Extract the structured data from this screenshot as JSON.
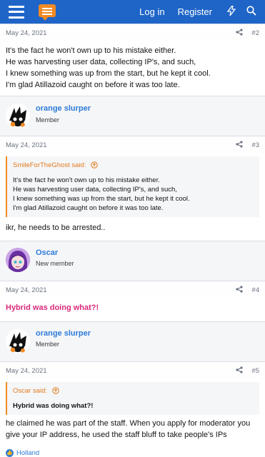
{
  "header": {
    "login": "Log in",
    "register": "Register",
    "menu_icon": "hamburger-icon",
    "logo_icon": "chat-bubble-logo",
    "whats_new_icon": "lightning-icon",
    "search_icon": "search-icon",
    "brand_color": "#1f65c8",
    "logo_color": "#f08a24"
  },
  "posts": [
    {
      "date": "May 24, 2021",
      "number": "#2",
      "lines": [
        "It's the fact he won't own up to his mistake either.",
        "He was harvesting user data, collecting IP's, and such,",
        "I knew something was up from the start, but he kept it cool.",
        "I'm glad Atillazoid caught on before it was too late."
      ]
    },
    {
      "user": "orange slurper",
      "role": "Member",
      "date": "May 24, 2021",
      "number": "#3",
      "quote_author": "SmileForTheGhost said:",
      "quote_lines": [
        "It's the fact he won't own up to his mistake either.",
        "He was harvesting user data, collecting IP's, and such,",
        "I knew something was up from the start, but he kept it cool.",
        "I'm glad Atillazoid caught on before it was too late."
      ],
      "text": "ikr, he needs to be arrested.."
    },
    {
      "user": "Oscar",
      "role": "New member",
      "date": "May 24, 2021",
      "number": "#4",
      "text": "Hybrid was doing what?!"
    },
    {
      "user": "orange slurper",
      "role": "Member",
      "date": "May 24, 2021",
      "number": "#5",
      "quote_author": "Oscar said:",
      "quote_text": "Hybrid was doing what?!",
      "lines": [
        "he claimed he was part of the staff. When you apply for moderator you",
        "give your IP address, he used the staff bluff to take people's IPs"
      ],
      "reaction": "Holland"
    }
  ],
  "icons": {
    "share": "share-icon",
    "quote_arrow": "arrow-up-circle-icon",
    "like": "thumbs-up-icon"
  },
  "colors": {
    "username": "#2e7bd8",
    "quote_author": "#e07a1e",
    "highlight": "#d8297b"
  }
}
